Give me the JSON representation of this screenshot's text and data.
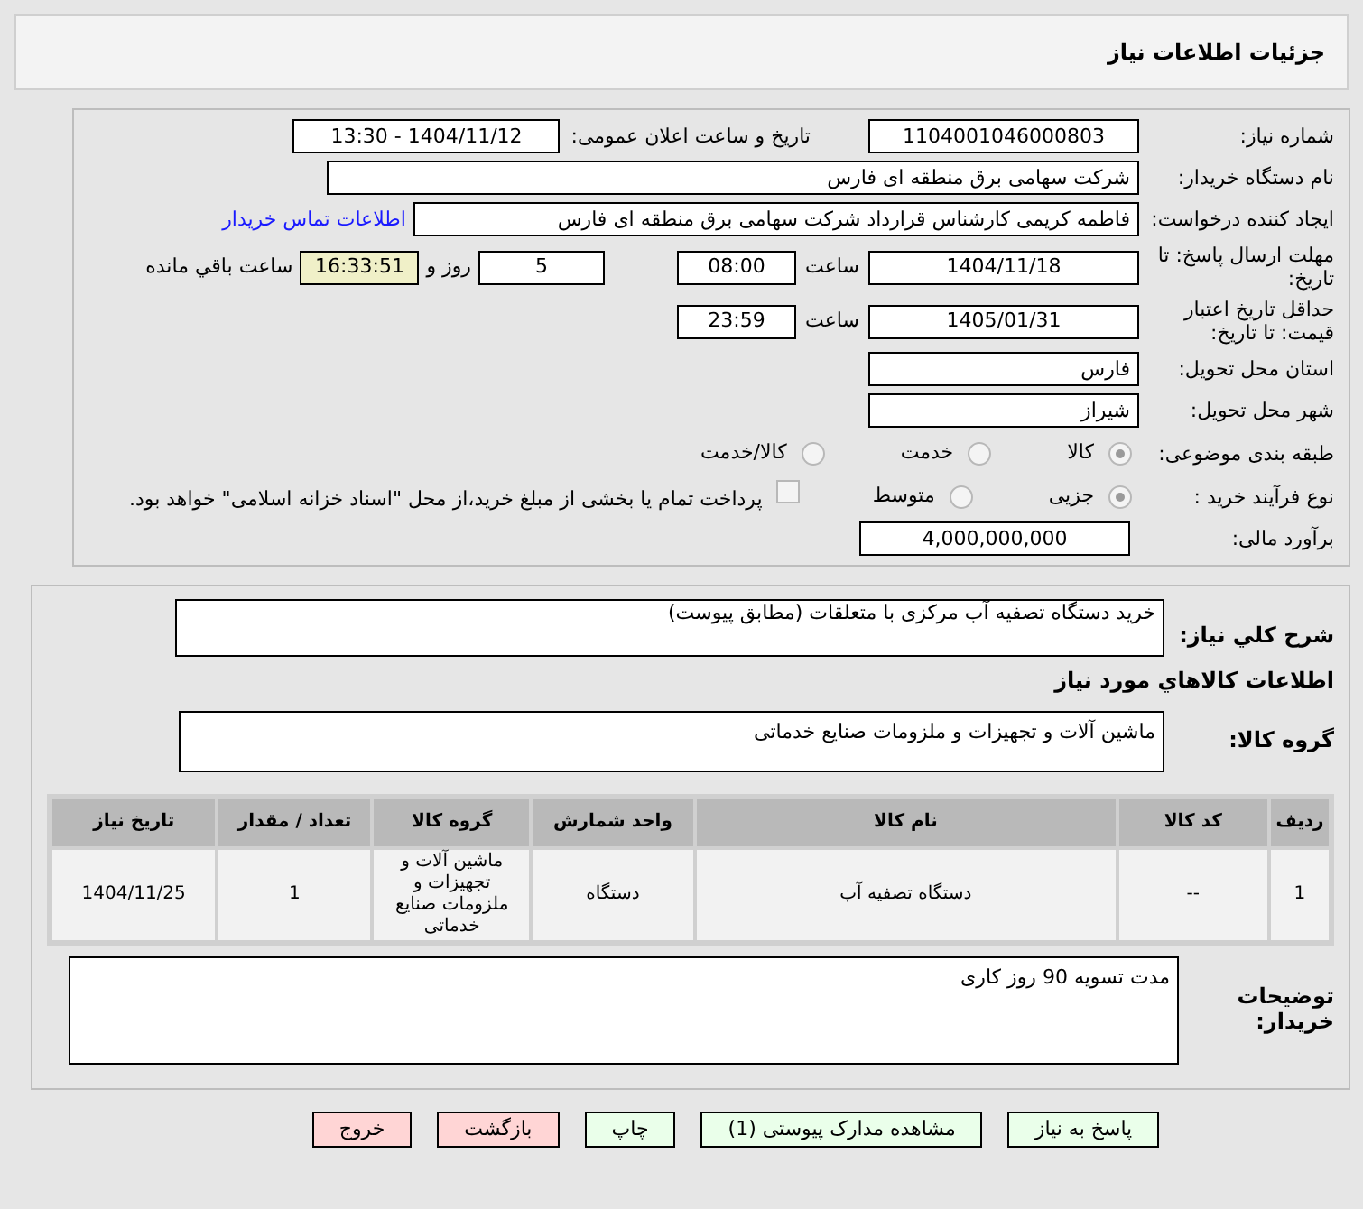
{
  "title": "جزئیات اطلاعات نیاز",
  "need_number": {
    "label": "شماره نیاز:",
    "value": "1104001046000803"
  },
  "announce": {
    "label": "تاریخ و ساعت اعلان عمومی:",
    "value": "1404/11/12 - 13:30"
  },
  "buyer": {
    "label": "نام دستگاه خریدار:",
    "value": "شرکت سهامی برق منطقه ای فارس"
  },
  "creator": {
    "label": "ایجاد کننده درخواست:",
    "value": "فاطمه کریمی کارشناس قرارداد شرکت سهامی برق منطقه ای فارس",
    "link": "اطلاعات تماس خریدار"
  },
  "deadline": {
    "label": "مهلت ارسال پاسخ: تا تاریخ:",
    "date": "1404/11/18",
    "time_label": "ساعت",
    "time": "08:00",
    "days": "5",
    "days_label": "روز و",
    "remaining": "16:33:51",
    "remaining_label": "ساعت باقي مانده"
  },
  "validity": {
    "label": "حداقل تاریخ اعتبار قیمت: تا تاریخ:",
    "date": "1405/01/31",
    "time_label": "ساعت",
    "time": "23:59"
  },
  "province": {
    "label": "استان محل تحویل:",
    "value": "فارس"
  },
  "city": {
    "label": "شهر محل تحویل:",
    "value": "شیراز"
  },
  "category": {
    "label": "طبقه بندی موضوعی:",
    "options": [
      {
        "label": "کالا",
        "selected": true
      },
      {
        "label": "خدمت",
        "selected": false
      },
      {
        "label": "کالا/خدمت",
        "selected": false
      }
    ]
  },
  "process": {
    "label": "نوع فرآیند خرید :",
    "options": [
      {
        "label": "جزیی",
        "selected": true
      },
      {
        "label": "متوسط",
        "selected": false
      }
    ],
    "checkbox": {
      "label": "پرداخت تمام یا بخشی از مبلغ خرید،از محل \"اسناد خزانه اسلامی\" خواهد بود.",
      "checked": false
    }
  },
  "estimate": {
    "label": "برآورد مالی:",
    "value": "4,000,000,000"
  },
  "description": {
    "label": "شرح کلي نياز:",
    "value": "خرید دستگاه تصفیه آب مرکزی با متعلقات (مطابق پیوست)"
  },
  "goods_title": "اطلاعات کالاهاي مورد نياز",
  "goods_group": {
    "label": "گروه کالا:",
    "value": "ماشین آلات و تجهیزات و ملزومات صنایع خدماتی"
  },
  "table": {
    "columns": [
      "ردیف",
      "کد کالا",
      "نام کالا",
      "واحد شمارش",
      "گروه کالا",
      "تعداد / مقدار",
      "تاریخ نیاز"
    ],
    "rows": [
      [
        "1",
        "--",
        "دستگاه تصفیه آب",
        "دستگاه",
        "ماشین آلات و تجهیزات و ملزومات صنایع خدماتی",
        "1",
        "1404/11/25"
      ]
    ]
  },
  "buyer_notes": {
    "label": "توضیحات خریدار:",
    "value": "مدت تسویه 90 روز کاری"
  },
  "buttons": [
    {
      "label": "پاسخ به نیاز",
      "color": "#eaffea"
    },
    {
      "label": "مشاهده مدارک پیوستی (1)",
      "color": "#eaffea"
    },
    {
      "label": "چاپ",
      "color": "#eaffea"
    },
    {
      "label": "بازگشت",
      "color": "#ffd5d5"
    },
    {
      "label": "خروج",
      "color": "#ffd5d5"
    }
  ]
}
